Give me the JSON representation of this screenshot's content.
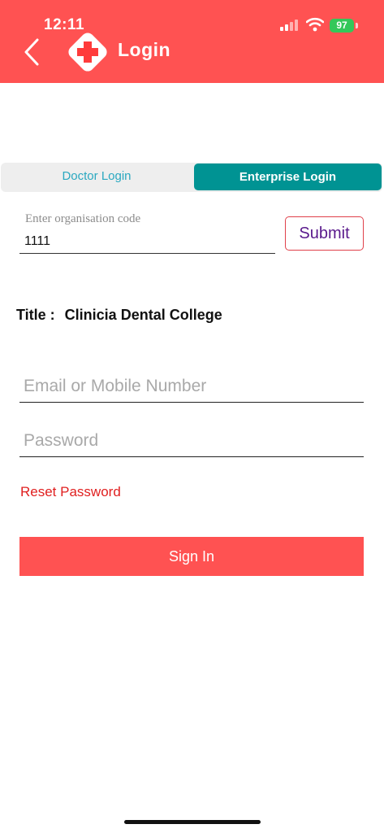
{
  "status_bar": {
    "time": "12:11",
    "battery": "97"
  },
  "header": {
    "title": "Login",
    "back_icon": "chevron-left-icon",
    "logo_icon": "medical-cross-icon"
  },
  "tabs": [
    {
      "label": "Doctor Login",
      "selected": false
    },
    {
      "label": "Enterprise Login",
      "selected": true
    }
  ],
  "org_code": {
    "label": "Enter organisation code",
    "value": "1111"
  },
  "submit_label": "Submit",
  "title_row": {
    "label": "Title :",
    "value": "Clinicia Dental College"
  },
  "email": {
    "placeholder": "Email or Mobile Number",
    "value": ""
  },
  "password": {
    "placeholder": "Password",
    "value": ""
  },
  "reset_label": "Reset Password",
  "signin_label": "Sign In",
  "colors": {
    "brand": "#ff5252",
    "tab_active": "#009393",
    "link": "#e02020"
  }
}
